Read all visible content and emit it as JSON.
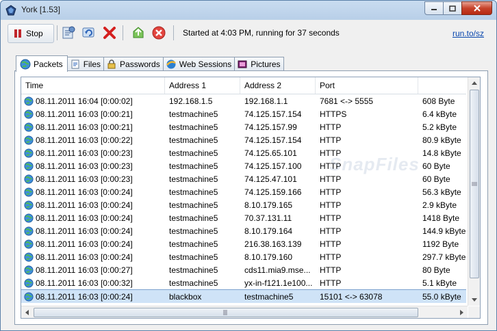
{
  "window": {
    "title": "York [1.53]",
    "min": "0",
    "max": "1",
    "close": "r"
  },
  "toolbar": {
    "stop_label": "Stop",
    "status": "Started at 4:03 PM, running for 37 seconds",
    "link": "run.to/sz"
  },
  "tabs": [
    {
      "label": "Packets",
      "icon": "globe-icon"
    },
    {
      "label": "Files",
      "icon": "file-icon"
    },
    {
      "label": "Passwords",
      "icon": "lock-icon"
    },
    {
      "label": "Web Sessions",
      "icon": "browser-icon"
    },
    {
      "label": "Pictures",
      "icon": "picture-icon"
    }
  ],
  "table": {
    "columns": [
      "Time",
      "Address 1",
      "Address 2",
      "Port",
      ""
    ],
    "rows": [
      [
        "08.11.2011 16:04 [0:00:02]",
        "192.168.1.5",
        "192.168.1.1",
        "7681 <-> 5555",
        "608 Byte"
      ],
      [
        "08.11.2011 16:03 [0:00:21]",
        "testmachine5",
        "74.125.157.154",
        "HTTPS",
        "6.4 kByte"
      ],
      [
        "08.11.2011 16:03 [0:00:21]",
        "testmachine5",
        "74.125.157.99",
        "HTTP",
        "5.2 kByte"
      ],
      [
        "08.11.2011 16:03 [0:00:22]",
        "testmachine5",
        "74.125.157.154",
        "HTTP",
        "80.9 kByte"
      ],
      [
        "08.11.2011 16:03 [0:00:23]",
        "testmachine5",
        "74.125.65.101",
        "HTTP",
        "14.8 kByte"
      ],
      [
        "08.11.2011 16:03 [0:00:23]",
        "testmachine5",
        "74.125.157.100",
        "HTTP",
        "60 Byte"
      ],
      [
        "08.11.2011 16:03 [0:00:23]",
        "testmachine5",
        "74.125.47.101",
        "HTTP",
        "60 Byte"
      ],
      [
        "08.11.2011 16:03 [0:00:24]",
        "testmachine5",
        "74.125.159.166",
        "HTTP",
        "56.3 kByte"
      ],
      [
        "08.11.2011 16:03 [0:00:24]",
        "testmachine5",
        "8.10.179.165",
        "HTTP",
        "2.9 kByte"
      ],
      [
        "08.11.2011 16:03 [0:00:24]",
        "testmachine5",
        "70.37.131.11",
        "HTTP",
        "1418 Byte"
      ],
      [
        "08.11.2011 16:03 [0:00:24]",
        "testmachine5",
        "8.10.179.164",
        "HTTP",
        "144.9 kByte"
      ],
      [
        "08.11.2011 16:03 [0:00:24]",
        "testmachine5",
        "216.38.163.139",
        "HTTP",
        "1192 Byte"
      ],
      [
        "08.11.2011 16:03 [0:00:24]",
        "testmachine5",
        "8.10.179.160",
        "HTTP",
        "297.7 kByte"
      ],
      [
        "08.11.2011 16:03 [0:00:27]",
        "testmachine5",
        "cds11.mia9.mse...",
        "HTTP",
        "80 Byte"
      ],
      [
        "08.11.2011 16:03 [0:00:32]",
        "testmachine5",
        "yx-in-f121.1e100...",
        "HTTP",
        "5.1 kByte"
      ],
      [
        "08.11.2011 16:03 [0:00:24]",
        "blackbox",
        "testmachine5",
        "15101 <-> 63078",
        "55.0 kByte"
      ]
    ]
  },
  "watermark": "SnapFiles",
  "colors": {
    "accent": "#0645ad",
    "selection": "#cfe3f7",
    "stop": "#c0262c"
  }
}
